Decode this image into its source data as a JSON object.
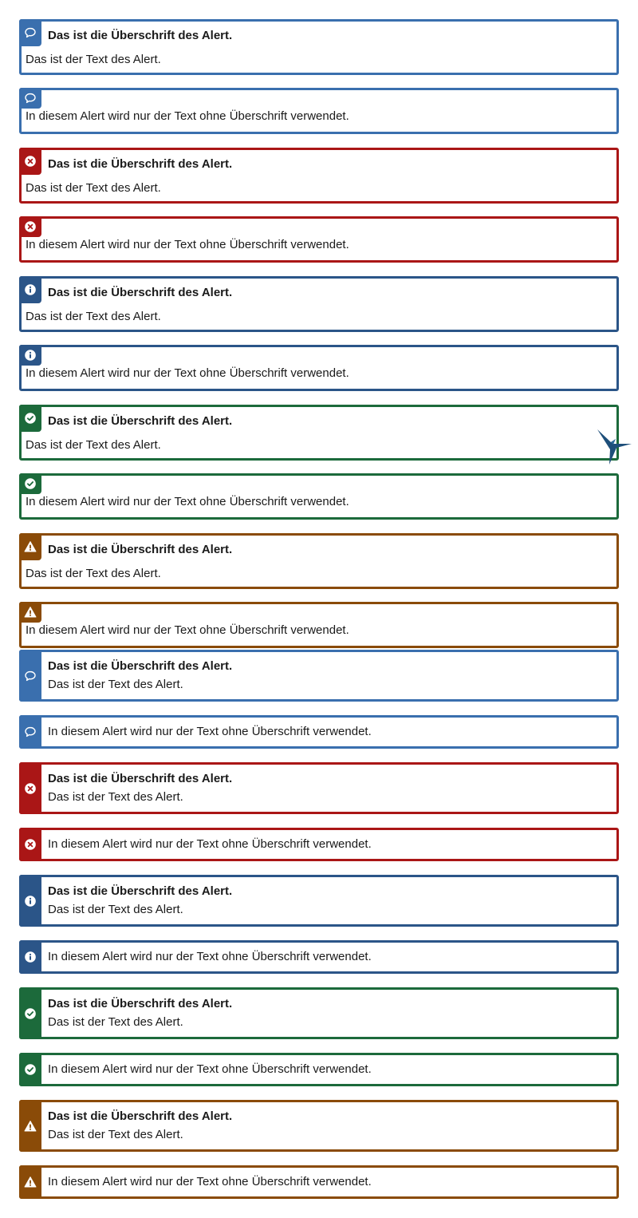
{
  "colors": {
    "blue": "#3a6fae",
    "red": "#aa1616",
    "navy": "#2b5588",
    "green": "#1c6a3b",
    "orange": "#8a4b08",
    "bird": "#1e4f7a"
  },
  "alerts": [
    {
      "title": "Das ist die Überschrift des Alert.",
      "text": "Das ist der Text des Alert.",
      "icon": "speech-bubble-icon"
    },
    {
      "title": "",
      "text": "In diesem Alert wird nur der Text ohne Überschrift verwendet.",
      "icon": "speech-bubble-icon"
    },
    {
      "title": "Das ist die Überschrift des Alert.",
      "text": "Das ist der Text des Alert.",
      "icon": "error-icon"
    },
    {
      "title": "",
      "text": "In diesem Alert wird nur der Text ohne Überschrift verwendet.",
      "icon": "error-icon"
    },
    {
      "title": "Das ist die Überschrift des Alert.",
      "text": "Das ist der Text des Alert.",
      "icon": "info-icon"
    },
    {
      "title": "",
      "text": "In diesem Alert wird nur der Text ohne Überschrift verwendet.",
      "icon": "info-icon"
    },
    {
      "title": "Das ist die Überschrift des Alert.",
      "text": "Das ist der Text des Alert.",
      "icon": "success-icon"
    },
    {
      "title": "",
      "text": "In diesem Alert wird nur der Text ohne Überschrift verwendet.",
      "icon": "success-icon"
    },
    {
      "title": "Das ist die Überschrift des Alert.",
      "text": "Das ist der Text des Alert.",
      "icon": "warning-icon"
    },
    {
      "title": "",
      "text": "In diesem Alert wird nur der Text ohne Überschrift verwendet.",
      "icon": "warning-icon"
    },
    {
      "title": "Das ist die Überschrift des Alert.",
      "text": "Das ist der Text des Alert.",
      "icon": "speech-bubble-icon"
    },
    {
      "title": "",
      "text": "In diesem Alert wird nur der Text ohne Überschrift verwendet.",
      "icon": "speech-bubble-icon"
    },
    {
      "title": "Das ist die Überschrift des Alert.",
      "text": "Das ist der Text des Alert.",
      "icon": "error-icon"
    },
    {
      "title": "",
      "text": "In diesem Alert wird nur der Text ohne Überschrift verwendet.",
      "icon": "error-icon"
    },
    {
      "title": "Das ist die Überschrift des Alert.",
      "text": "Das ist der Text des Alert.",
      "icon": "info-icon"
    },
    {
      "title": "",
      "text": "In diesem Alert wird nur der Text ohne Überschrift verwendet.",
      "icon": "info-icon"
    },
    {
      "title": "Das ist die Überschrift des Alert.",
      "text": "Das ist der Text des Alert.",
      "icon": "success-icon"
    },
    {
      "title": "",
      "text": "In diesem Alert wird nur der Text ohne Überschrift verwendet.",
      "icon": "success-icon"
    },
    {
      "title": "Das ist die Überschrift des Alert.",
      "text": "Das ist der Text des Alert.",
      "icon": "warning-icon"
    },
    {
      "title": "",
      "text": "In diesem Alert wird nur der Text ohne Überschrift verwendet.",
      "icon": "warning-icon"
    }
  ],
  "floating_icon": "bird-logo-icon"
}
